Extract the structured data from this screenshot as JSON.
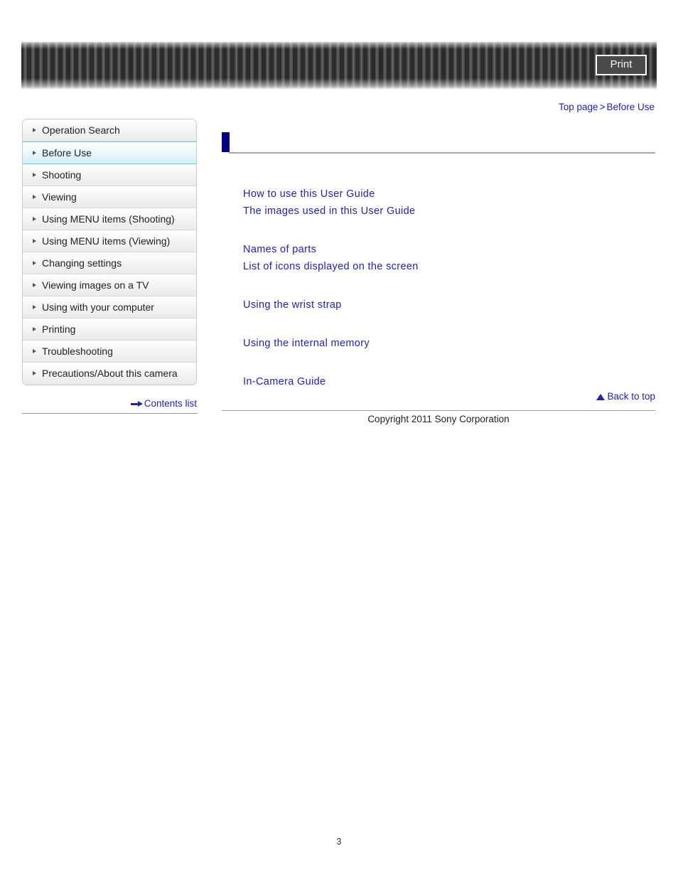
{
  "header": {
    "banner_title": "",
    "print_label": "Print"
  },
  "breadcrumb": {
    "top_page": "Top page",
    "separator": ">",
    "current": "Before Use"
  },
  "sidebar": {
    "items": [
      {
        "label": "Operation Search",
        "active": false
      },
      {
        "label": "Before Use",
        "active": true
      },
      {
        "label": "Shooting",
        "active": false
      },
      {
        "label": "Viewing",
        "active": false
      },
      {
        "label": "Using MENU items (Shooting)",
        "active": false
      },
      {
        "label": "Using MENU items (Viewing)",
        "active": false
      },
      {
        "label": "Changing settings",
        "active": false
      },
      {
        "label": "Viewing images on a TV",
        "active": false
      },
      {
        "label": "Using with your computer",
        "active": false
      },
      {
        "label": "Printing",
        "active": false
      },
      {
        "label": "Troubleshooting",
        "active": false
      },
      {
        "label": "Precautions/About this camera",
        "active": false
      }
    ],
    "contents_list_label": "Contents list"
  },
  "main": {
    "heading": "",
    "link_groups": [
      {
        "links": [
          "How to use this User Guide",
          "The images used in this User Guide"
        ]
      },
      {
        "links": [
          "Names of parts",
          "List of icons displayed on the screen"
        ]
      },
      {
        "links": [
          "Using the wrist strap"
        ]
      },
      {
        "links": [
          "Using the internal memory"
        ]
      },
      {
        "links": [
          "In-Camera Guide"
        ]
      }
    ],
    "back_to_top_label": "Back to top"
  },
  "footer": {
    "copyright": "Copyright 2011 Sony Corporation",
    "page_number": "3"
  },
  "colors": {
    "link": "#2222aa",
    "heading_mark": "#000080",
    "active_nav_border": "#5fd2ea",
    "banner": "#3a3a3a"
  }
}
